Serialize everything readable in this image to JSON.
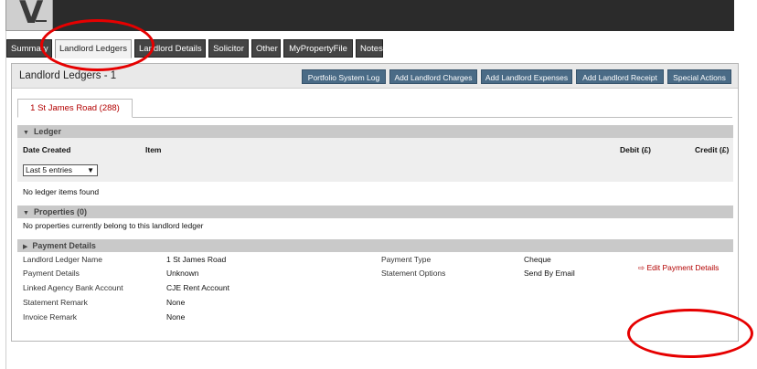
{
  "colors": {
    "accent_red": "#b30000",
    "button_blue": "#4a6b86",
    "annotation_red": "#e60000"
  },
  "logo": {
    "glyph": "V"
  },
  "tabs": [
    {
      "label": "Summary",
      "active": false
    },
    {
      "label": "Landlord Ledgers",
      "active": true
    },
    {
      "label": "Landlord Details",
      "active": false
    },
    {
      "label": "Solicitor",
      "active": false
    },
    {
      "label": "Other",
      "active": false
    },
    {
      "label": "MyPropertyFile",
      "active": false
    },
    {
      "label": "Notes",
      "active": false
    }
  ],
  "panel": {
    "title": "Landlord Ledgers - 1",
    "buttons": {
      "portfolio_log": "Portfolio System Log",
      "add_charges": "Add Landlord Charges",
      "add_expenses": "Add Landlord Expenses",
      "add_receipt": "Add Landlord Receipt",
      "special_actions": "Special Actions"
    }
  },
  "property_tab": "1 St James Road (288)",
  "ledger": {
    "section_title": "Ledger",
    "columns": {
      "date_created": "Date Created",
      "item": "Item",
      "debit": "Debit (£)",
      "credit": "Credit (£)"
    },
    "filter_value": "Last 5 entries",
    "empty_message": "No ledger items found"
  },
  "properties": {
    "section_title": "Properties (0)",
    "empty_message": "No properties currently belong to this landlord ledger"
  },
  "payment_details": {
    "section_title": "Payment Details",
    "fields": {
      "ledger_name_label": "Landlord Ledger Name",
      "ledger_name_value": "1 St James Road",
      "payment_details_label": "Payment Details",
      "payment_details_value": "Unknown",
      "bank_account_label": "Linked Agency Bank Account",
      "bank_account_value": "CJE Rent Account",
      "statement_remark_label": "Statement Remark",
      "statement_remark_value": "None",
      "invoice_remark_label": "Invoice Remark",
      "invoice_remark_value": "None",
      "payment_type_label": "Payment Type",
      "payment_type_value": "Cheque",
      "statement_options_label": "Statement Options",
      "statement_options_value": "Send By Email"
    },
    "edit_link": "Edit Payment Details"
  }
}
